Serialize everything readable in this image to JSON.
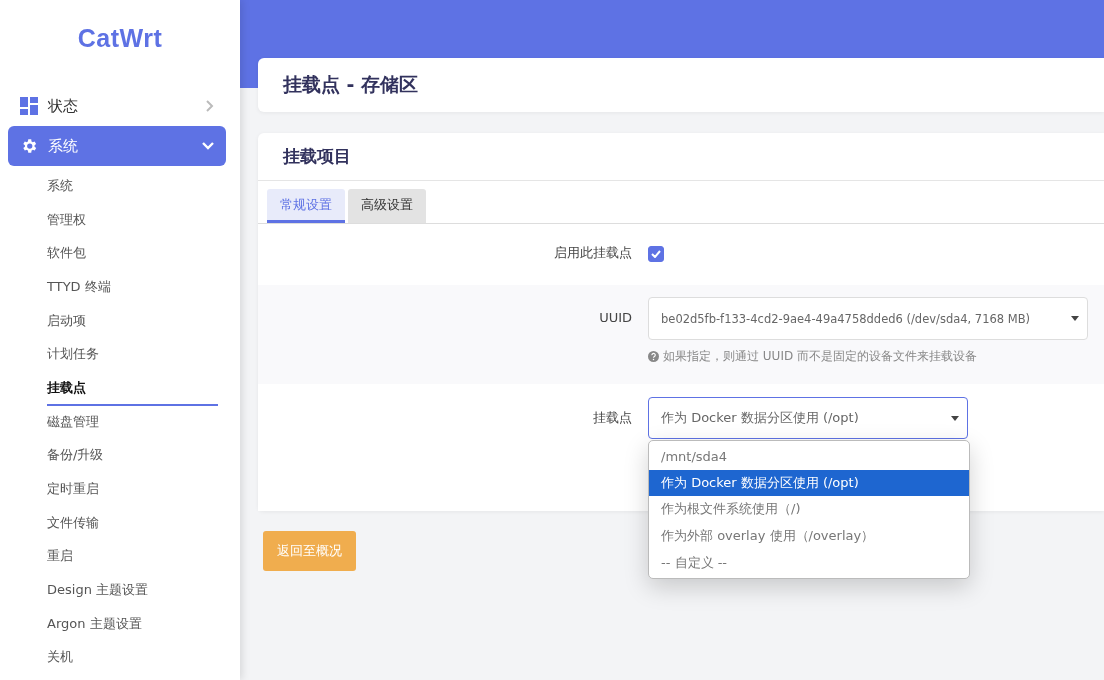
{
  "sidebar": {
    "logo": "CatWrt",
    "items": [
      {
        "label": "状态",
        "kind": "dashboard",
        "expanded": false,
        "selected": false
      },
      {
        "label": "系统",
        "kind": "gear",
        "expanded": true,
        "selected": true,
        "children": [
          {
            "label": "系统",
            "selected": false
          },
          {
            "label": "管理权",
            "selected": false
          },
          {
            "label": "软件包",
            "selected": false
          },
          {
            "label": "TTYD 终端",
            "selected": false
          },
          {
            "label": "启动项",
            "selected": false
          },
          {
            "label": "计划任务",
            "selected": false
          },
          {
            "label": "挂载点",
            "selected": true
          },
          {
            "label": "磁盘管理",
            "selected": false
          },
          {
            "label": "备份/升级",
            "selected": false
          },
          {
            "label": "定时重启",
            "selected": false
          },
          {
            "label": "文件传输",
            "selected": false
          },
          {
            "label": "重启",
            "selected": false
          },
          {
            "label": "Design 主题设置",
            "selected": false
          },
          {
            "label": "Argon 主题设置",
            "selected": false
          },
          {
            "label": "关机",
            "selected": false
          }
        ]
      }
    ]
  },
  "page_title": "挂载点 - 存储区",
  "section": {
    "title": "挂载项目",
    "tabs": [
      {
        "label": "常规设置",
        "selected": true
      },
      {
        "label": "高级设置",
        "selected": false
      }
    ],
    "fields": [
      {
        "kind": "checkbox",
        "label": "启用此挂载点",
        "checked": true
      },
      {
        "kind": "select",
        "label": "UUID",
        "value": "be02d5fb-f133-4cd2-9ae4-49a4758dded6 (/dev/sda4, 7168 MB)",
        "hint": "如果指定，则通过 UUID 而不是固定的设备文件来挂载设备",
        "expanded": false
      },
      {
        "kind": "select",
        "label": "挂载点",
        "value": "作为 Docker 数据分区使用 (/opt)",
        "expanded": true,
        "options": [
          {
            "label": "/mnt/sda4",
            "selected": false
          },
          {
            "label": "作为 Docker 数据分区使用 (/opt)",
            "selected": true
          },
          {
            "label": "作为根文件系统使用（/)",
            "selected": false
          },
          {
            "label": "作为外部 overlay 使用（/overlay）",
            "selected": false
          },
          {
            "label": "-- 自定义 --",
            "selected": false
          }
        ]
      }
    ]
  },
  "back_button": "返回至概况"
}
